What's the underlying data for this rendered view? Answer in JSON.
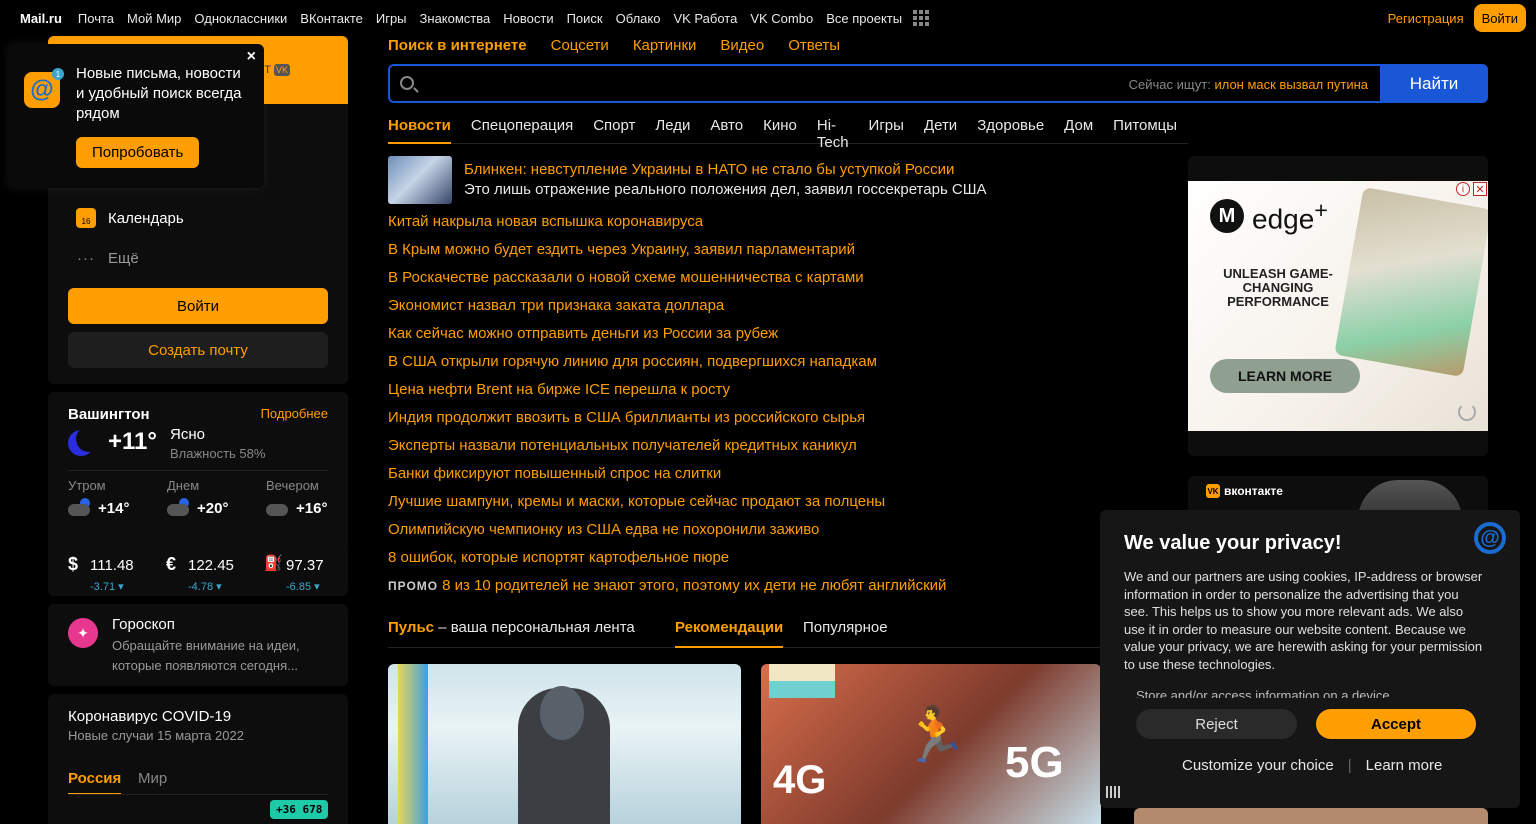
{
  "topnav": {
    "brand": "Mail.ru",
    "items": [
      "Почта",
      "Мой Мир",
      "Одноклассники",
      "ВКонтакте",
      "Игры",
      "Знакомства",
      "Новости",
      "Поиск",
      "Облако",
      "VK Работа",
      "VK Combo",
      "Все проекты"
    ],
    "register": "Регистрация",
    "login": "Войти"
  },
  "popup": {
    "text": "Новые письма, новости и удобный поиск всегда рядом",
    "try": "Попробовать",
    "close": "×",
    "badge": "1"
  },
  "mail": {
    "header_fragment": "CT",
    "vk_mark": "VK",
    "age": "0+",
    "calendar": "Календарь",
    "calendar_day": "16",
    "more": "Ещё",
    "login": "Войти",
    "create": "Создать почту"
  },
  "weather": {
    "city": "Вашингтон",
    "more": "Подробнее",
    "temp": "+11°",
    "condition": "Ясно",
    "humidity": "Влажность 58%",
    "parts": [
      {
        "label": "Утром",
        "temp": "+14°"
      },
      {
        "label": "Днем",
        "temp": "+20°"
      },
      {
        "label": "Вечером",
        "temp": "+16°"
      }
    ]
  },
  "rates": [
    {
      "symbol": "$",
      "value": "111.48",
      "change": "-3.71 ▾"
    },
    {
      "symbol": "€",
      "value": "122.45",
      "change": "-4.78 ▾"
    },
    {
      "symbol": "⛽",
      "value": "97.37",
      "change": "-6.85 ▾"
    }
  ],
  "horoscope": {
    "title": "Гороскоп",
    "desc": "Обращайте внимание на идеи, которые появляются сегодня..."
  },
  "covid": {
    "title": "Коронавирус COVID-19",
    "sub": "Новые случаи 15 марта 2022",
    "tab_russia": "Россия",
    "tab_world": "Мир",
    "badge": "+36 678"
  },
  "search": {
    "tabs": [
      "Поиск в интернете",
      "Соцсети",
      "Картинки",
      "Видео",
      "Ответы"
    ],
    "hint_label": "Сейчас ищут:",
    "hint_query": "илон маск вызвал путина",
    "button": "Найти"
  },
  "news_tabs": [
    "Новости",
    "Спецоперация",
    "Спорт",
    "Леди",
    "Авто",
    "Кино",
    "Hi-Tech",
    "Игры",
    "Дети",
    "Здоровье",
    "Дом",
    "Питомцы"
  ],
  "top_news": {
    "headline": "Блинкен: невступление Украины в НАТО не стало бы уступкой России",
    "sub": "Это лишь отражение реального положения дел, заявил госсекретарь США"
  },
  "news": [
    "Китай накрыла новая вспышка коронавируса",
    "В Крым можно будет ездить через Украину, заявил парламентарий",
    "В Роскачестве рассказали о новой схеме мошенничества с картами",
    "Экономист назвал три признака заката доллара",
    "Как сейчас можно отправить деньги из России за рубеж",
    "В США открыли горячую линию для россиян, подвергшихся нападкам",
    "Цена нефти Brent на бирже ICE перешла к росту",
    "Индия продолжит ввозить в США бриллианты из российского сырья",
    "Эксперты назвали потенциальных получателей кредитных каникул",
    "Банки фиксируют повышенный спрос на слитки",
    "Лучшие шампуни, кремы и маски, которые сейчас продают за полцены",
    "Олимпийскую чемпионку из США едва не похоронили заживо",
    "8 ошибок, которые испортят картофельное пюре"
  ],
  "promo": {
    "tag": "ПРОМО",
    "text": "8 из 10 родителей не знают этого, поэтому их дети не любят английский"
  },
  "pulse": {
    "title": "Пульс",
    "subtitle": " – ваша персональная лента",
    "recommendations": "Рекомендации",
    "popular": "Популярное",
    "card2_left": "4G",
    "card2_right": "5G"
  },
  "ad": {
    "brand": "edge",
    "brand_sup": "+",
    "logo": "M",
    "slogan": "UNLEASH GAME-CHANGING PERFORMANCE",
    "cta": "LEARN MORE",
    "info": "i",
    "close": "✕"
  },
  "vk": {
    "label": "вконтакте",
    "mark": "VK"
  },
  "cookie": {
    "title": "We value your privacy!",
    "body": "We and our partners are using cookies, IP-address or browser information in order to personalize the advertising that you see. This helps us to show you more relevant ads. We also use it in order to measure our website content. Because we value your privacy, we are herewith asking for your permission to use these technologies.",
    "item": "Store and/or access information on a device",
    "reject": "Reject",
    "accept": "Accept",
    "customize": "Customize your choice",
    "separator": "|",
    "learn": "Learn more",
    "logo": "@"
  }
}
